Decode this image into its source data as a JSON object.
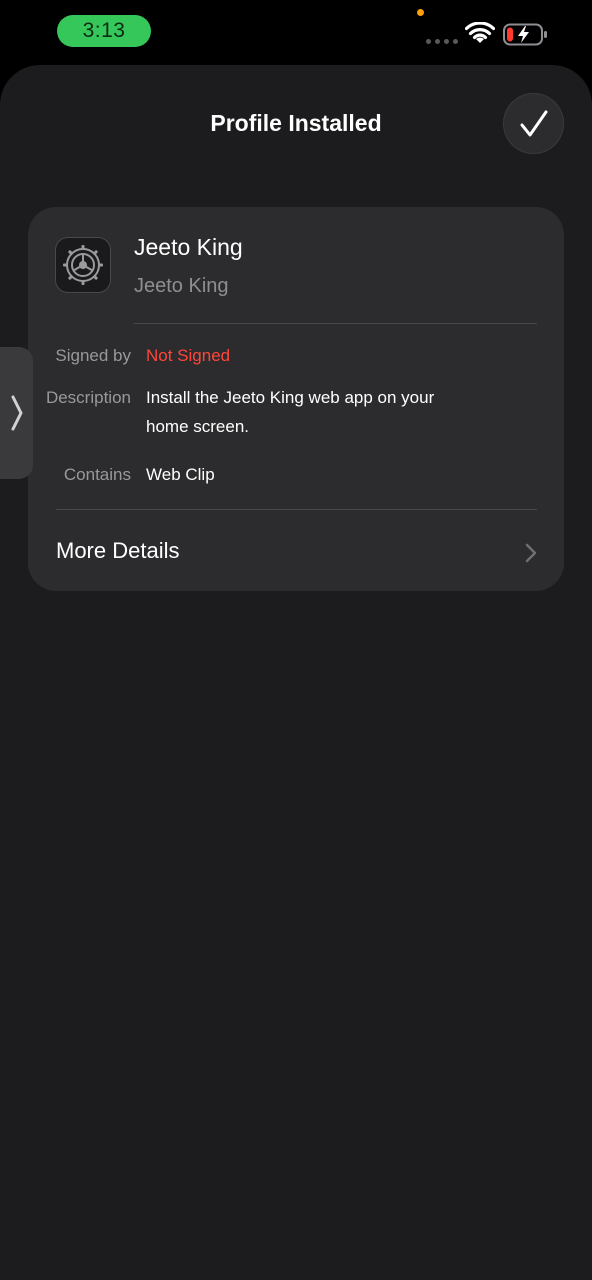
{
  "status_bar": {
    "time": "3:13",
    "time_pill_color": "#35c759",
    "icons": [
      "privacy-dot",
      "signal-dots",
      "wifi-icon",
      "battery-charging-icon"
    ]
  },
  "sheet": {
    "title": "Profile Installed",
    "done_icon": "checkmark-icon"
  },
  "profile": {
    "icon": "settings-gear-icon",
    "name": "Jeeto King",
    "subtitle": "Jeeto King",
    "details": {
      "signed_by_label": "Signed by",
      "signed_by_value": "Not Signed",
      "signed_by_color": "#ff453a",
      "description_label": "Description",
      "description_value": "Install the Jeeto King web app on your home screen.",
      "contains_label": "Contains",
      "contains_value": "Web Clip"
    },
    "more_details_label": "More Details"
  },
  "side_handle": {
    "icon": "chevron-right-icon"
  }
}
